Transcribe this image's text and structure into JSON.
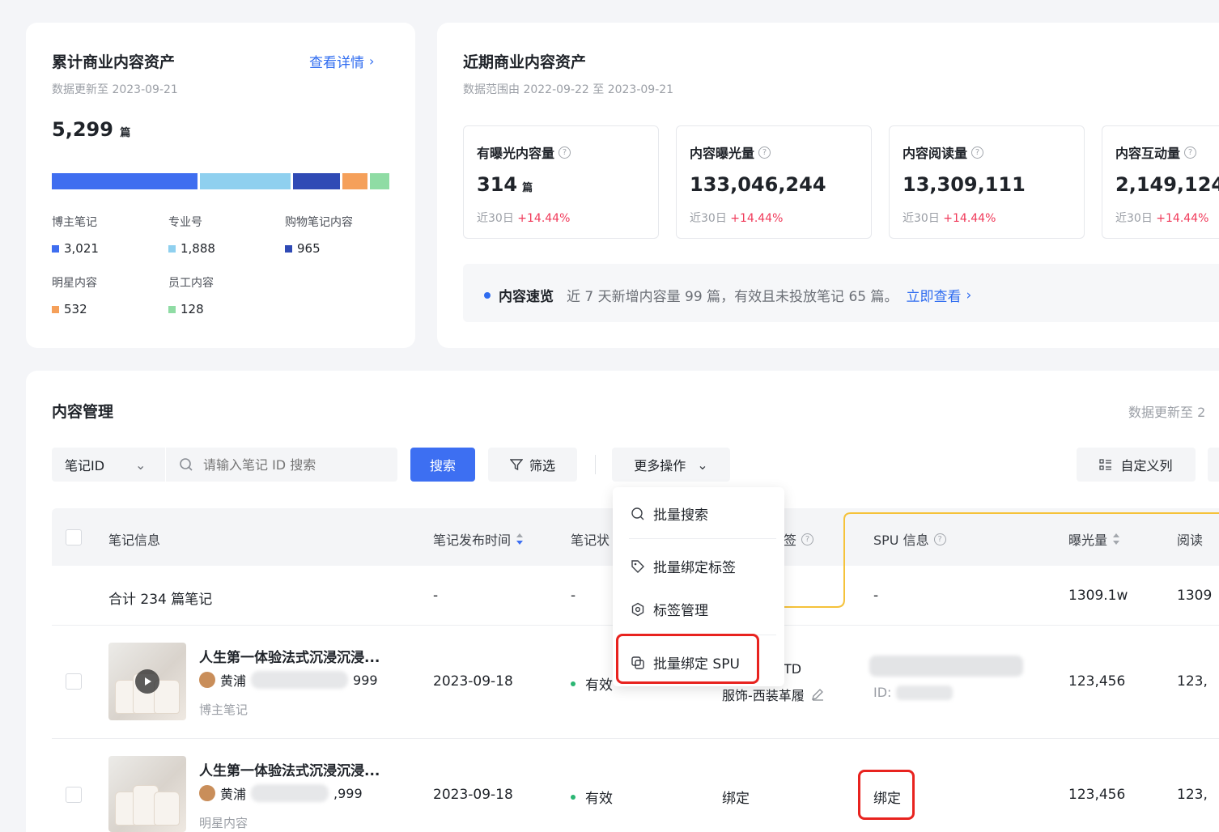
{
  "cumulative": {
    "title": "累计商业内容资产",
    "details_link": "查看详情",
    "updated": "数据更新至 2023-09-21",
    "total": "5,299",
    "total_unit": "篇",
    "bar_segments": [
      {
        "name": "博主笔记",
        "value": 3021,
        "color": "#3f6ef0"
      },
      {
        "name": "专业号",
        "value": 1888,
        "color": "#8fd0ef"
      },
      {
        "name": "购物笔记内容",
        "value": 965,
        "color": "#2f4ab5"
      },
      {
        "name": "明星内容",
        "value": 532,
        "color": "#f5a05a"
      },
      {
        "name": "员工内容",
        "value": 128,
        "color": "#8fdca4"
      }
    ],
    "legend": [
      {
        "label": "博主笔记",
        "value": "3,021",
        "color": "#3f6ef0"
      },
      {
        "label": "专业号",
        "value": "1,888",
        "color": "#8fd0ef"
      },
      {
        "label": "购物笔记内容",
        "value": "965",
        "color": "#2f4ab5"
      },
      {
        "label": "明星内容",
        "value": "532",
        "color": "#f5a05a"
      },
      {
        "label": "员工内容",
        "value": "128",
        "color": "#8fdca4"
      }
    ]
  },
  "recent": {
    "title": "近期商业内容资产",
    "range": "数据范围由 2022-09-22 至 2023-09-21",
    "metrics": [
      {
        "label": "有曝光内容量",
        "value": "314",
        "unit": "篇",
        "period": "近30日",
        "change": "+14.44%"
      },
      {
        "label": "内容曝光量",
        "value": "133,046,244",
        "unit": "",
        "period": "近30日",
        "change": "+14.44%"
      },
      {
        "label": "内容阅读量",
        "value": "13,309,111",
        "unit": "",
        "period": "近30日",
        "change": "+14.44%"
      },
      {
        "label": "内容互动量",
        "value": "2,149,124",
        "unit": "",
        "period": "近30日",
        "change": "+14.44%"
      }
    ],
    "overview_label": "内容速览",
    "overview_text": "近 7 天新增内容量 99 篇，有效且未投放笔记 65 篇。",
    "overview_link": "立即查看"
  },
  "management": {
    "title": "内容管理",
    "updated": "数据更新至 2",
    "id_select": "笔记ID",
    "search_placeholder": "请输入笔记 ID 搜索",
    "search_button": "搜索",
    "filter_button": "筛选",
    "more_button": "更多操作",
    "custom_columns": "自定义列",
    "menu": [
      "批量搜索",
      "批量绑定标签",
      "标签管理",
      "批量绑定 SPU"
    ],
    "columns": {
      "info": "笔记信息",
      "publish": "笔记发布时间",
      "status": "笔记状",
      "tag": "签",
      "spu": "SPU 信息",
      "exposure": "曝光量",
      "reads": "阅读"
    },
    "summary": {
      "label": "合计 234 篇笔记",
      "publish": "-",
      "status": "-",
      "spu": "-",
      "exposure": "1309.1w",
      "reads": "1309"
    },
    "rows": [
      {
        "title": "人生第一体验法式沉浸沉浸...",
        "author": "黄浦",
        "author_tail": "999",
        "type": "博主笔记",
        "date": "2023-09-18",
        "status": "有效",
        "tag_top": "TD",
        "tag": "服饰-西装革履",
        "spu_id": "ID:",
        "exposure": "123,456",
        "reads": "123,"
      },
      {
        "title": "人生第一体验法式沉浸沉浸...",
        "author": "黄浦",
        "author_tail": ",999",
        "type": "明星内容",
        "date": "2023-09-18",
        "status": "有效",
        "tag_bind": "绑定",
        "spu_bind": "绑定",
        "exposure": "123,456",
        "reads": "123,"
      }
    ]
  }
}
